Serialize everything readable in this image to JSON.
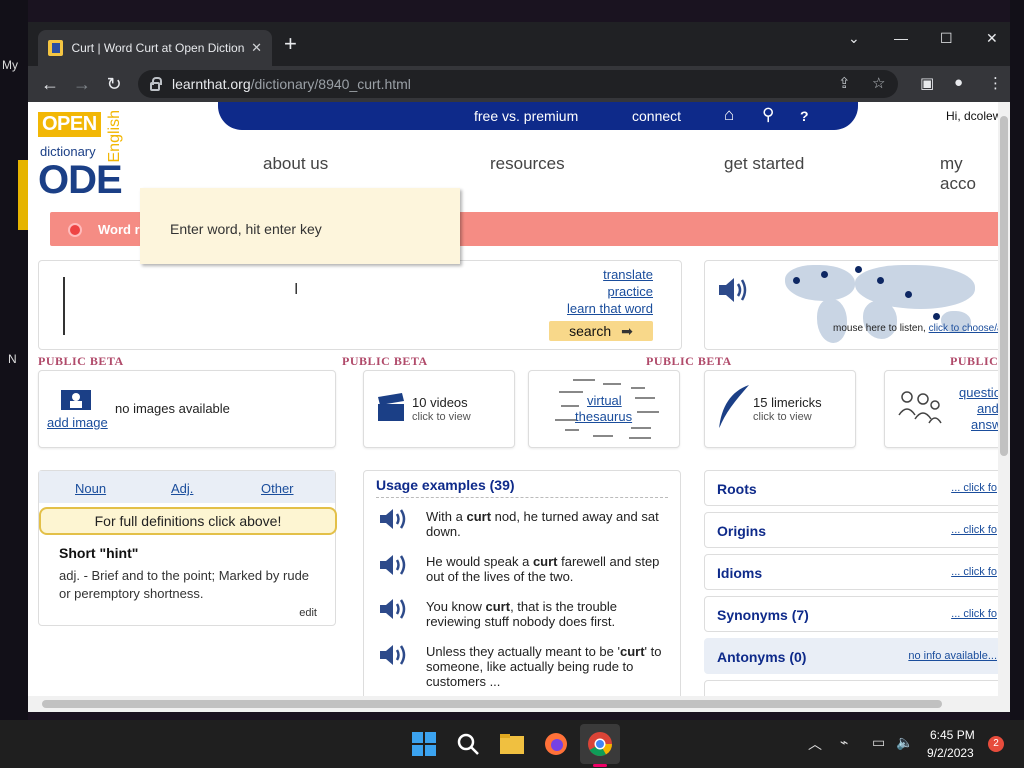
{
  "desktop": {
    "left_text": "My",
    "left_text2": "N"
  },
  "browser": {
    "tab_title": "Curt | Word Curt at Open Dictionary",
    "tab_close": "✕",
    "new_tab": "+",
    "url_host": "learnthat.org",
    "url_path": "/dictionary/8940_curt.html",
    "win_min": "—",
    "win_max": "☐",
    "win_close": "✕",
    "win_menu": "⌄"
  },
  "site": {
    "logo": {
      "open": "OPEN",
      "dictionary": "dictionary",
      "ode": "ODE",
      "english": "English"
    },
    "topbar": {
      "free": "free vs. premium",
      "connect": "connect",
      "home": "⌂",
      "search": "⚲",
      "help": "?"
    },
    "greeting": "Hi, dcolew",
    "nav": {
      "about": "about us",
      "resources": "resources",
      "started": "get started",
      "account": "my acco"
    },
    "notice": "Word r",
    "tooltip": "Enter word, hit enter key",
    "search": {
      "translate": "translate",
      "practice": "practice",
      "learn": "learn that word",
      "button": "search"
    },
    "audio": {
      "note": "mouse here to listen, ",
      "choose": "click to choose/add"
    },
    "beta": "PUBLIC BETA",
    "beta_cut": "PUBLIC",
    "cards": {
      "images": "no images available",
      "add_image": "add image",
      "videos": "10 videos",
      "videos_sub": "click to view",
      "thesaurus_line1": "virtual",
      "thesaurus_line2": "thesaurus",
      "limericks": "15 limericks",
      "limericks_sub": "click to view",
      "qa_line1": "questio",
      "qa_line2": "and",
      "qa_line3": "answe"
    },
    "pos": {
      "noun": "Noun",
      "adj": "Adj.",
      "other": "Other",
      "full_def": "For full definitions click above!",
      "hint_title": "Short \"hint\"",
      "hint_body": "adj. - Brief and to the point; Marked by rude or peremptory shortness.",
      "edit": "edit"
    },
    "usage": {
      "title": "Usage examples (39)",
      "examples": [
        {
          "pre": "With a ",
          "bold": "curt",
          "post": " nod, he turned away and sat down."
        },
        {
          "pre": "He would speak a ",
          "bold": "curt",
          "post": " farewell and step out of the lives of the two."
        },
        {
          "pre": "You know ",
          "bold": "curt",
          "post": ", that is the trouble reviewing stuff nobody does first."
        },
        {
          "pre": "Unless they actually meant to be '",
          "bold": "curt",
          "post": "' to someone, like actually being rude to customers ..."
        }
      ]
    },
    "sections": [
      {
        "label": "Roots",
        "link": "... click fo"
      },
      {
        "label": "Origins",
        "link": "... click fo"
      },
      {
        "label": "Idioms",
        "link": "... click fo"
      },
      {
        "label": "Synonyms (7)",
        "link": "... click fo"
      },
      {
        "label": "Antonyms (0)",
        "link": "no info available..."
      }
    ]
  },
  "taskbar": {
    "time": "6:45 PM",
    "date": "9/2/2023",
    "notifications": "2",
    "chevron": "︿"
  }
}
